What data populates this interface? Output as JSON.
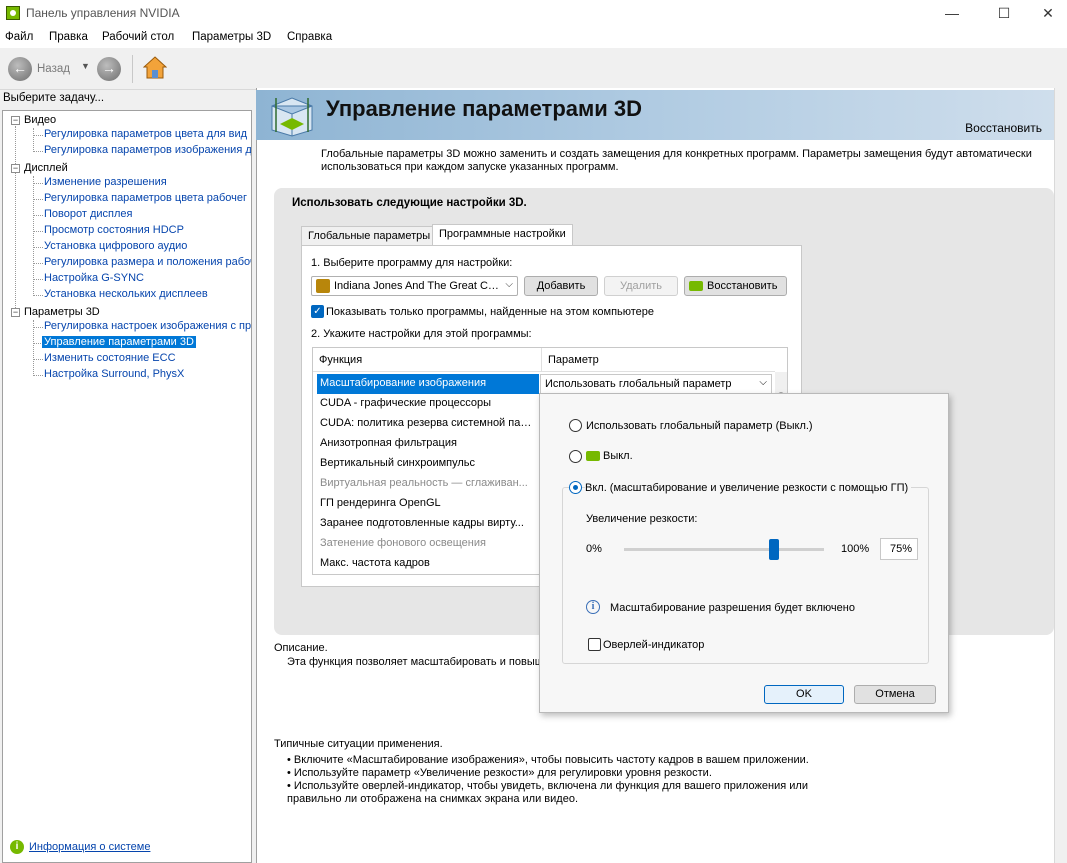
{
  "window": {
    "title": "Панель управления NVIDIA",
    "controls": [
      "—",
      "☐",
      "✕"
    ]
  },
  "menu": [
    "Файл",
    "Правка",
    "Рабочий стол",
    "Параметры 3D",
    "Справка"
  ],
  "toolbar": {
    "back_label": "Назад"
  },
  "left": {
    "header": "Выберите задачу...",
    "categories": [
      {
        "label": "Видео",
        "items": [
          "Регулировка параметров цвета для вид",
          "Регулировка параметров изображения д"
        ]
      },
      {
        "label": "Дисплей",
        "items": [
          "Изменение разрешения",
          "Регулировка параметров цвета рабочег",
          "Поворот дисплея",
          "Просмотр состояния HDCP",
          "Установка цифрового аудио",
          "Регулировка размера и положения рабоч",
          "Настройка G-SYNC",
          "Установка нескольких дисплеев"
        ]
      },
      {
        "label": "Параметры 3D",
        "items": [
          "Регулировка настроек изображения с пр",
          "Управление параметрами 3D",
          "Изменить состояние ECC",
          "Настройка Surround, PhysX"
        ]
      }
    ],
    "system_info": "Информация о системе"
  },
  "page": {
    "title": "Управление параметрами 3D",
    "restore": "Восстановить",
    "intro_line1": "Глобальные параметры 3D можно заменить и создать замещения для конкретных программ. Параметры замещения будут автоматически",
    "intro_line2": "использоваться при каждом запуске указанных программ.",
    "settings_header": "Использовать следующие настройки 3D.",
    "tabs": [
      "Глобальные параметры",
      "Программные настройки"
    ],
    "step1": "1. Выберите программу для настройки:",
    "program": "Indiana Jones And The Great Ci...",
    "btn_add": "Добавить",
    "btn_remove": "Удалить",
    "btn_restore": "Восстановить",
    "show_only": "Показывать только программы, найденные на этом компьютере",
    "step2": "2. Укажите настройки для этой программы:",
    "col_function": "Функция",
    "col_param": "Параметр",
    "rows": [
      "Масштабирование изображения",
      "CUDA - графические процессоры",
      "CUDA: политика резерва системной пам...",
      "Анизотропная фильтрация",
      "Вертикальный синхроимпульс",
      "Виртуальная реальность — сглаживан...",
      "ГП рендеринга OpenGL",
      "Заранее подготовленные кадры вирту...",
      "Затенение фонового освещения",
      "Макс. частота кадров"
    ],
    "selected_value": "Использовать глобальный параметр",
    "description_label": "Описание.",
    "description_text": "Эта функция позволяет масштабировать и повыш",
    "usage_title": "Типичные ситуации применения.",
    "usage": [
      "• Включите «Масштабирование изображения», чтобы повысить частоту кадров в вашем приложении.",
      "• Используйте параметр «Увеличение резкости» для регулировки уровня резкости.",
      "• Используйте оверлей-индикатор, чтобы увидеть, включена ли функция для вашего приложения или",
      "правильно ли отображена на снимках экрана или видео."
    ]
  },
  "popup": {
    "opt_global": "Использовать глобальный параметр (Выкл.)",
    "opt_off": "Выкл.",
    "opt_on": "Вкл. (масштабирование и увеличение резкости с помощью ГП)",
    "sharpen_label": "Увеличение резкости:",
    "min": "0%",
    "max": "100%",
    "value": "75%",
    "sharpen_level": 0.75,
    "info": "Масштабирование разрешения будет включено",
    "overlay": "Оверлей-индикатор",
    "ok": "OK",
    "cancel": "Отмена"
  }
}
